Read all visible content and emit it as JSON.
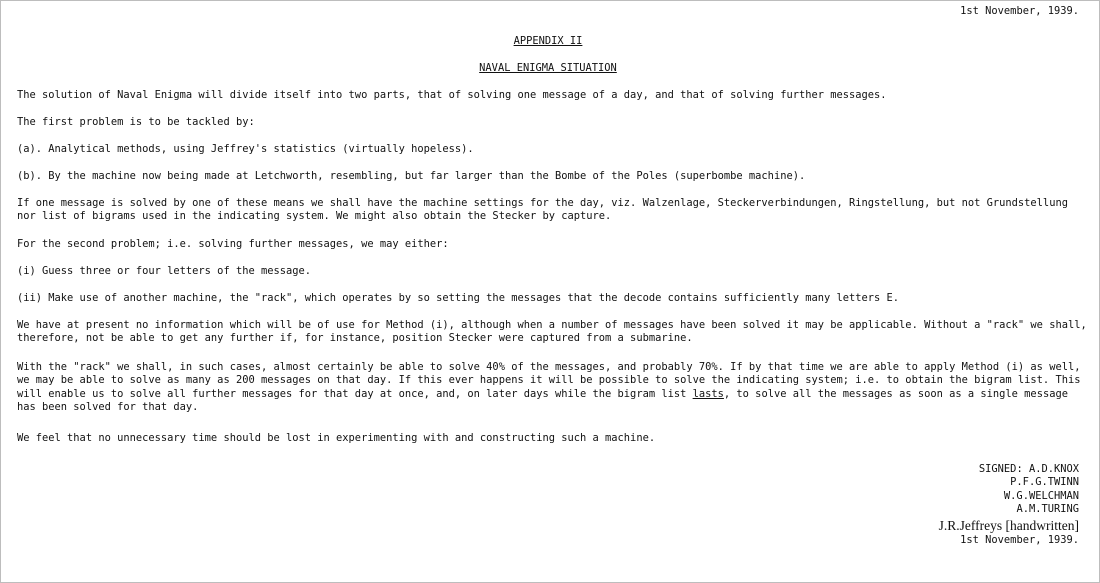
{
  "header": {
    "date": "1st November, 1939."
  },
  "title": "APPENDIX II",
  "subtitle": "NAVAL ENIGMA SITUATION",
  "paragraphs": {
    "p1": [
      "The solution of Naval Enigma will divide itself into two parts, that of solving one message of a day, and that of solving further messages."
    ],
    "p2": [
      "The first problem is to be tackled by:"
    ],
    "p3": [
      "(a). Analytical methods, using Jeffrey's statistics (virtually hopeless)."
    ],
    "p4": [
      "(b). By the machine now being made at Letchworth, resembling, but far larger than the Bombe of the Poles (superbombe machine)."
    ],
    "p5": [
      "If one message is solved by one of these means we shall have the machine settings for the day, viz. Walzenlage, Steckerverbindungen, Ringstellung, but not Grundstellung",
      "nor list of bigrams used in the indicating system. We might also obtain the Stecker by capture."
    ],
    "p6": [
      "For the second problem; i.e. solving further messages, we may either:"
    ],
    "p7": [
      "(i) Guess three or four letters of the message."
    ],
    "p8": [
      "(ii) Make use of another machine, the \"rack\", which operates by so setting the messages that the decode contains sufficiently many letters E."
    ],
    "p9": [
      "We have at present no information which will be of use for Method (i), although when a number of messages have been solved it may be applicable. Without a \"rack\" we shall,",
      "therefore, not be able to get any further if, for instance, position Stecker were captured from a submarine."
    ],
    "p10": {
      "lines": [
        "With the \"rack\" we shall, in such cases, almost certainly be able to solve 40% of the messages, and probably 70%. If by that time we are able to apply Method (i) as well,",
        "we may be able to solve as many as 200 messages on that day. If this ever happens it will be possible to solve the indicating system; i.e. to obtain the bigram list. This"
      ],
      "line3_before": "will enable us to solve all further messages for that day at once, and, on later days while the bigram list ",
      "line3_underlined": "lasts",
      "line3_after": ", to solve all the messages as soon as a single message",
      "line4": "has been solved for that day."
    },
    "p11": [
      "We feel that no unnecessary time should be lost in experimenting with and constructing such a machine."
    ]
  },
  "signature": {
    "signed": "SIGNED: A.D.KNOX",
    "names": [
      "P.F.G.TWINN",
      "W.G.WELCHMAN",
      "A.M.TURING"
    ],
    "handwritten": "J.R.Jeffreys [handwritten]",
    "date": "1st November, 1939."
  }
}
